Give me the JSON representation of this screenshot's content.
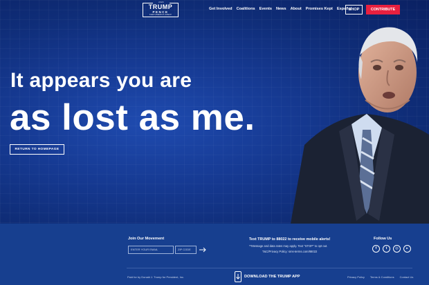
{
  "header": {
    "logo": {
      "top": "2020",
      "line1": "TRUMP",
      "line2": "PENCE",
      "line3": "KEEP AMERICA GREAT"
    },
    "nav": [
      "Get Involved",
      "Coalitions",
      "Events",
      "News",
      "About",
      "Promises Kept",
      "Español"
    ],
    "shop_label": "SHOP",
    "contribute_label": "CONTRIBUTE"
  },
  "hero": {
    "line1": "It appears you are",
    "line2": "as lost as me.",
    "button_label": "RETURN TO HOMEPAGE"
  },
  "footer": {
    "join_title": "Join Our Movement",
    "email_placeholder": "ENTER YOUR EMAIL",
    "zip_placeholder": "ZIP CODE",
    "sms_title": "Text TRUMP to 88022 to receive mobile alerts!",
    "sms_note": "**Message and data rates may apply. Text \"STOP\" to opt out.",
    "sms_policy": "T&C/Privacy Policy: sms-terms.com/88022",
    "follow_title": "Follow Us",
    "socials": [
      "facebook-icon",
      "twitter-icon",
      "instagram-icon",
      "youtube-icon"
    ],
    "paid_for": "Paid for by Donald J. Trump for President, Inc.",
    "app_label": "DOWNLOAD THE TRUMP APP",
    "links": [
      "Privacy Policy",
      "Terms & Conditions",
      "Contact Us"
    ]
  },
  "colors": {
    "hero_blue": "#163a93",
    "footer_blue": "#173f8f",
    "contribute_red": "#e8203f"
  }
}
